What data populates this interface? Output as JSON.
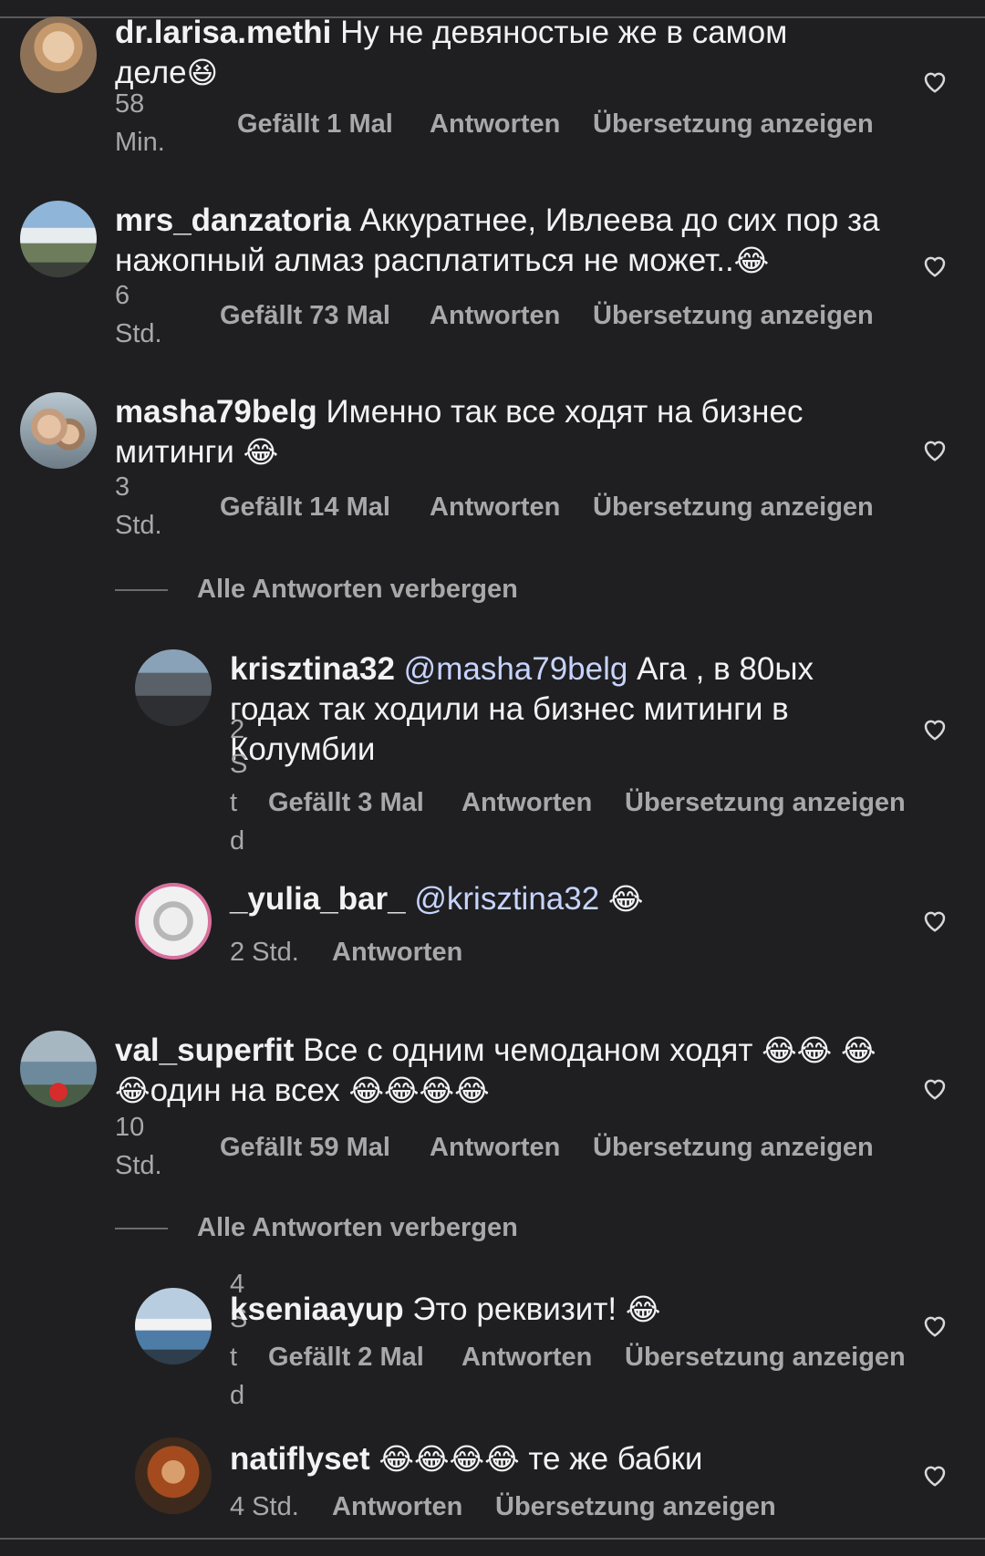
{
  "comments": [
    {
      "user": "dr.larisa.methi",
      "text": "Ну не девяностые же в самом деле",
      "emoji": "😆",
      "time_line1": "58",
      "time_line2": "Min.",
      "likes": "Gefällt 1 Mal",
      "reply": "Antworten",
      "translate": "Übersetzung anzeigen"
    },
    {
      "user": "mrs_danzatoria",
      "text": "Аккуратнее, Ивлеева до сих пор за нажопный алмаз расплатиться не может..",
      "emoji": "😂",
      "time_line1": "6",
      "time_line2": "Std.",
      "likes": "Gefällt 73 Mal",
      "reply": "Antworten",
      "translate": "Übersetzung anzeigen"
    },
    {
      "user": "masha79belg",
      "text": "Именно так все ходят на бизнес митинги",
      "emoji": "😂",
      "time_line1": "3",
      "time_line2": "Std.",
      "likes": "Gefällt 14 Mal",
      "reply": "Antworten",
      "translate": "Übersetzung anzeigen",
      "hide_replies": "Alle Antworten verbergen",
      "replies": [
        {
          "user": "krisztina32",
          "mention": "@masha79belg",
          "text": "Ага , в 80ых годах так ходили на бизнес митинги в Колумбии",
          "time_chars": [
            "2",
            "S",
            "t",
            "d"
          ],
          "likes": "Gefällt 3 Mal",
          "reply": "Antworten",
          "translate": "Übersetzung anzeigen"
        },
        {
          "user": "_yulia_bar_",
          "mention": "@krisztina32",
          "emoji": "😂",
          "time": "2 Std.",
          "reply": "Antworten"
        }
      ]
    },
    {
      "user": "val_superfit",
      "text": "Все с одним чемоданом ходят",
      "emoji_a": "😂😂",
      "emoji_b": "😂😂",
      "text2": "один на всех",
      "emoji_c": "😂😂😂😂",
      "time_line1": "10",
      "time_line2": "Std.",
      "likes": "Gefällt 59 Mal",
      "reply": "Antworten",
      "translate": "Übersetzung anzeigen",
      "hide_replies": "Alle Antworten verbergen",
      "replies": [
        {
          "user": "kseniaayup",
          "text": "Это реквизит!",
          "emoji": "😂",
          "time_chars": [
            "4",
            "S",
            "t",
            "d"
          ],
          "likes": "Gefällt 2 Mal",
          "reply": "Antworten",
          "translate": "Übersetzung anzeigen"
        },
        {
          "user": "natiflyset",
          "emoji": "😂😂😂😂",
          "text": "те же бабки",
          "time": "4 Std.",
          "reply": "Antworten",
          "translate": "Übersetzung anzeigen"
        }
      ]
    }
  ],
  "icons": {
    "heart": "heart-outline-icon"
  }
}
